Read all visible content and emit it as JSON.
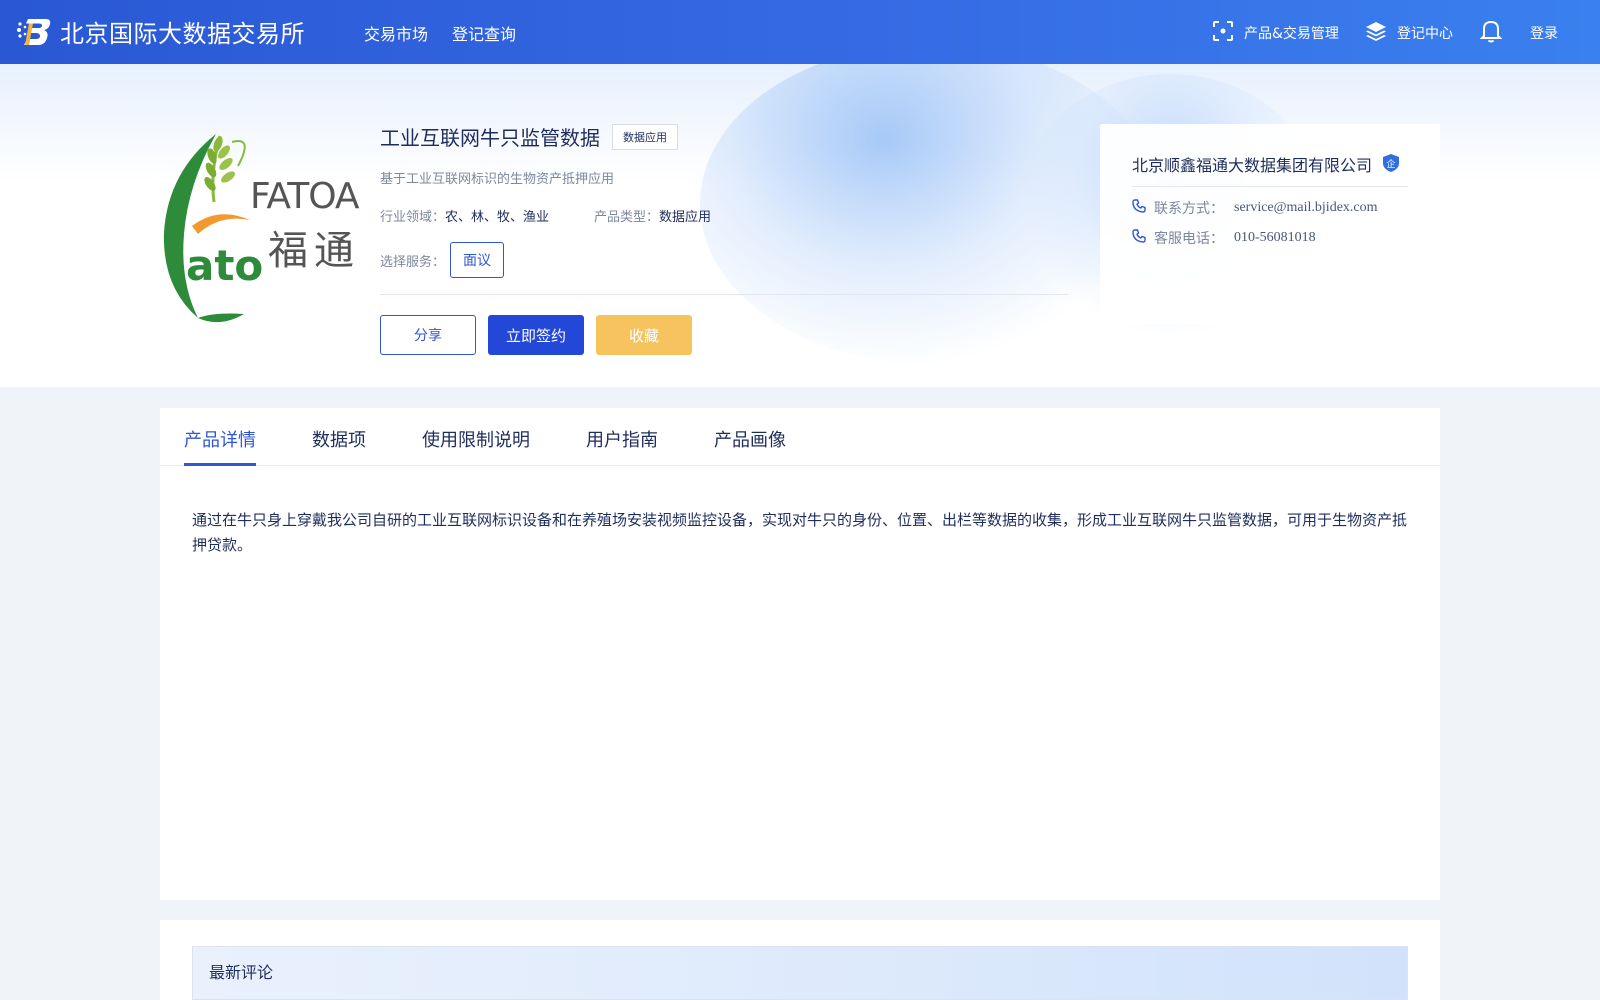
{
  "header": {
    "site_name": "北京国际大数据交易所",
    "nav": [
      {
        "label": "交易市场"
      },
      {
        "label": "登记查询"
      }
    ],
    "right": {
      "product_management": "产品&交易管理",
      "registration_center": "登记中心",
      "login": "登录"
    },
    "icons": [
      "brand-logo-icon",
      "scan-icon",
      "layers-icon",
      "bell-icon"
    ]
  },
  "product": {
    "logo_text": "FATOAN",
    "logo_cn": "福通",
    "title": "工业互联网牛只监管数据",
    "tag": "数据应用",
    "subtitle": "基于工业互联网标识的生物资产抵押应用",
    "industry_label": "行业领域：",
    "industry_value": "农、林、牧、渔业",
    "type_label": "产品类型：",
    "type_value": "数据应用",
    "service_label": "选择服务：",
    "service_option": "面议",
    "buttons": {
      "share": "分享",
      "sign": "立即签约",
      "favorite": "收藏"
    }
  },
  "company": {
    "name": "北京顺鑫福通大数据集团有限公司",
    "badge": "企",
    "contact_label": "联系方式：",
    "contact_value": "service@mail.bjidex.com",
    "phone_label": "客服电话：",
    "phone_value": "010-56081018"
  },
  "tabs": [
    {
      "label": "产品详情",
      "active": true
    },
    {
      "label": "数据项"
    },
    {
      "label": "使用限制说明"
    },
    {
      "label": "用户指南"
    },
    {
      "label": "产品画像"
    }
  ],
  "detail": {
    "description": "通过在牛只身上穿戴我公司自研的工业互联网标识设备和在养殖场安装视频监控设备，实现对牛只的身份、位置、出栏等数据的收集，形成工业互联网牛只监管数据，可用于生物资产抵押贷款。"
  },
  "comments": {
    "title": "最新评论"
  },
  "colors": {
    "primary": "#2f56d6",
    "header_start": "#2a58d4",
    "header_end": "#3a80ee",
    "favorite": "#f7c35e",
    "text_dark": "#1f2d5c",
    "text_muted": "#7d879e"
  }
}
